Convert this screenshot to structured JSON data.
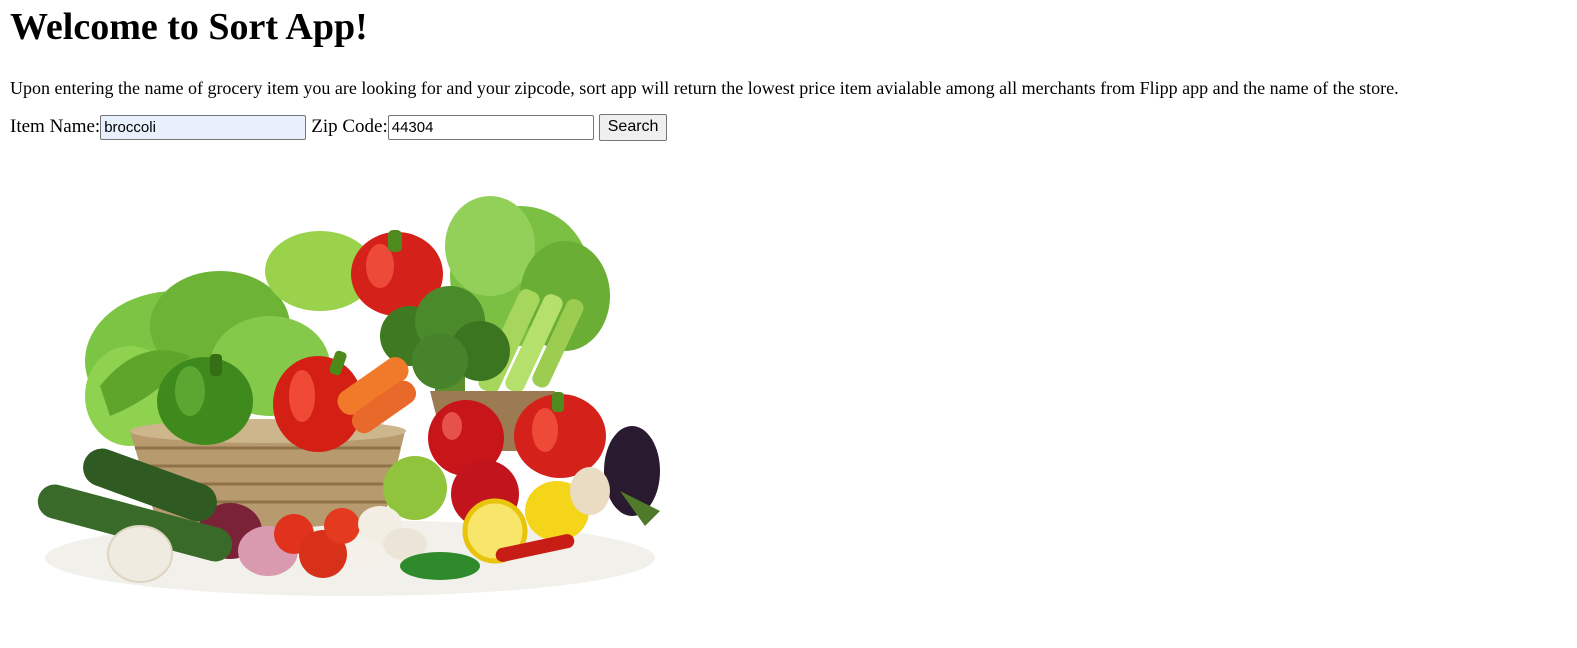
{
  "page": {
    "title": "Welcome to Sort App!",
    "description": "Upon entering the name of grocery item you are looking for and your zipcode, sort app will return the lowest price item avialable among all merchants from Flipp app and the name of the store."
  },
  "form": {
    "item_label": "Item Name:",
    "item_value": "broccoli",
    "zip_label": "Zip Code:",
    "zip_value": "44304",
    "search_label": "Search"
  },
  "image": {
    "subject": "vegetables-basket-image"
  }
}
